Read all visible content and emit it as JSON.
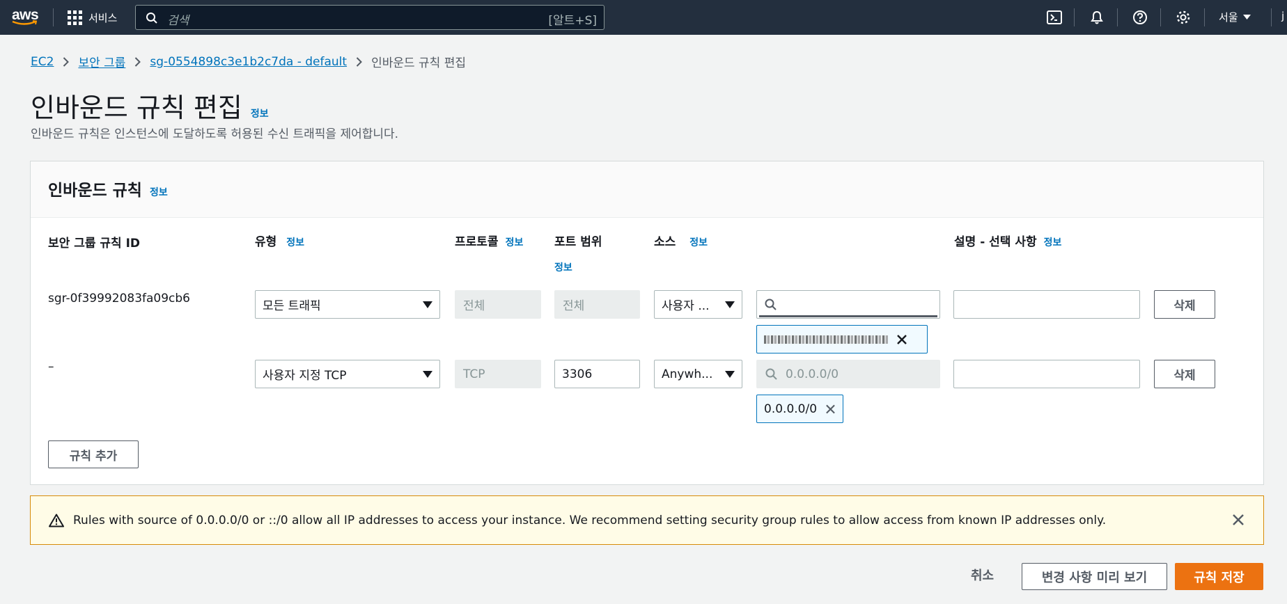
{
  "nav": {
    "logo_text": "aws",
    "services_label": "서비스",
    "search_placeholder": "검색",
    "search_shortcut": "[알트+S]",
    "region_label": "서울",
    "user_initial": "j"
  },
  "breadcrumb": {
    "items": [
      "EC2",
      "보안 그룹",
      "sg-0554898c3e1b2c7da - default"
    ],
    "current": "인바운드 규칙 편집"
  },
  "page": {
    "title": "인바운드 규칙 편집",
    "info": "정보",
    "description": "인바운드 규칙은 인스턴스에 도달하도록 허용된 수신 트래픽을 제어합니다."
  },
  "rules": {
    "header": "인바운드 규칙",
    "info": "정보",
    "columns": {
      "rule_id": "보안 그룹 규칙 ID",
      "type": "유형",
      "protocol": "프로토콜",
      "port_range": "포트 범위",
      "source": "소스",
      "description": "설명 - 선택 사항",
      "info": "정보"
    },
    "rows": [
      {
        "rule_id": "sgr-0f39992083fa09cb6",
        "type": "모든 트래픽",
        "protocol": "전체",
        "port_range": "전체",
        "source_type": "사용자 ...",
        "source_value": "",
        "token": "",
        "description": "",
        "delete_label": "삭제"
      },
      {
        "rule_id": "–",
        "type": "사용자 지정 TCP",
        "protocol": "TCP",
        "port_range": "3306",
        "source_type": "Anywh...",
        "source_placeholder": "0.0.0.0/0",
        "token": "0.0.0.0/0",
        "description": "",
        "delete_label": "삭제"
      }
    ],
    "add_rule_label": "규칙 추가"
  },
  "warning": {
    "text": "Rules with source of 0.0.0.0/0 or ::/0 allow all IP addresses to access your instance. We recommend setting security group rules to allow access from known IP addresses only."
  },
  "footer": {
    "cancel_label": "취소",
    "preview_label": "변경 사항 미리 보기",
    "save_label": "규칙 저장"
  },
  "colors": {
    "nav_bg": "#232f3e",
    "link": "#0073bb",
    "primary": "#ec7211",
    "warning_border": "#d78b08"
  }
}
